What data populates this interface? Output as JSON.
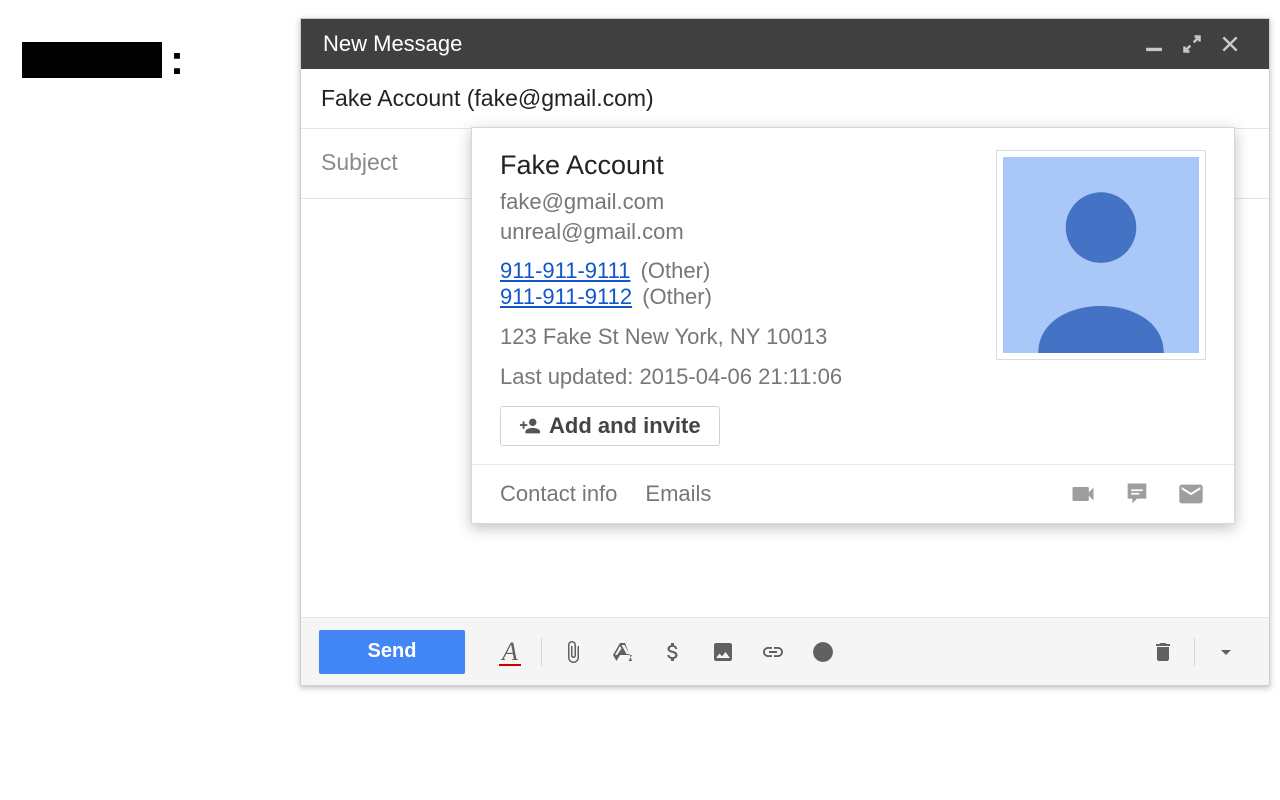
{
  "redacted": {
    "colon": ":"
  },
  "compose": {
    "title": "New Message",
    "to_display": "Fake Account (fake@gmail.com)",
    "subject_placeholder": "Subject",
    "send_label": "Send"
  },
  "contact_card": {
    "name": "Fake Account",
    "emails": [
      "fake@gmail.com",
      "unreal@gmail.com"
    ],
    "phones": [
      {
        "number": "911-911-9111",
        "type": "(Other)"
      },
      {
        "number": "911-911-9112",
        "type": "(Other)"
      }
    ],
    "address": "123 Fake St New York, NY 10013",
    "last_updated": "Last updated: 2015-04-06 21:11:06",
    "add_invite": "Add and invite",
    "tabs": {
      "contact_info": "Contact info",
      "emails": "Emails"
    }
  }
}
